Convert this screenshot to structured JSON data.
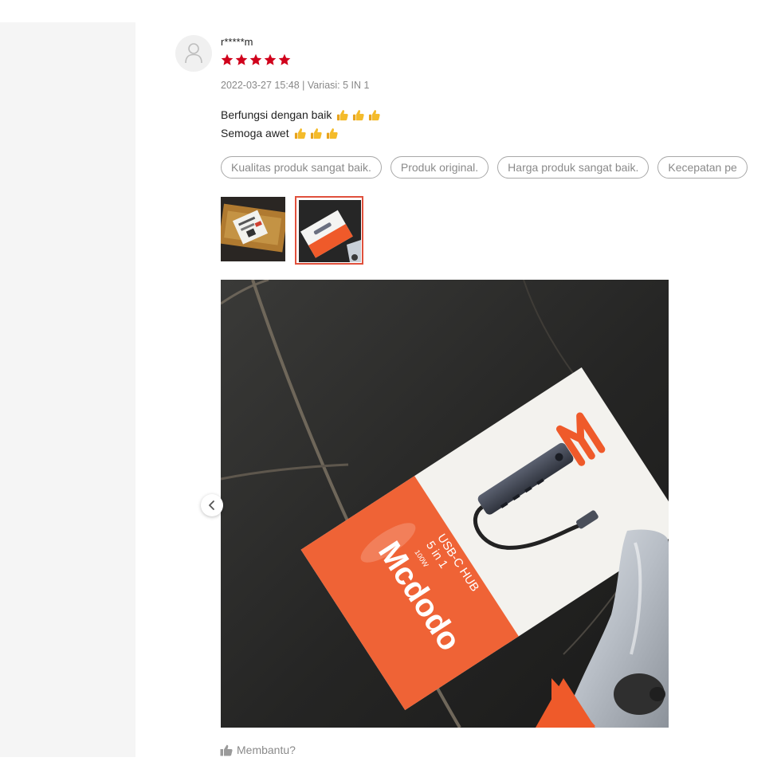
{
  "review": {
    "username": "r*****m",
    "rating": 5,
    "meta": "2022-03-27 15:48 | Variasi: 5 IN 1",
    "body_lines": [
      {
        "text": "Berfungsi dengan baik",
        "emoji_count": 3
      },
      {
        "text": "Semoga awet",
        "emoji_count": 3
      }
    ],
    "tags": [
      "Kualitas produk sangat baik.",
      "Produk original.",
      "Harga produk sangat baik.",
      "Kecepatan pe"
    ],
    "photo": {
      "box_brand": "Mcdodo",
      "box_line1": "5 in 1",
      "box_line2": "USB-C HUB",
      "box_spec": "100W"
    },
    "helpful_label": "Membantu?"
  },
  "colors": {
    "star": "#d0011b",
    "selected_border": "#e0503c",
    "brand_orange": "#ef5a2a",
    "muted_text": "#888888"
  },
  "icons": {
    "avatar": "user-icon",
    "rating": "star-icon",
    "emoji": "thumbs-up-emoji",
    "carousel_prev": "chevron-left-icon",
    "helpful": "thumbs-up-icon"
  }
}
